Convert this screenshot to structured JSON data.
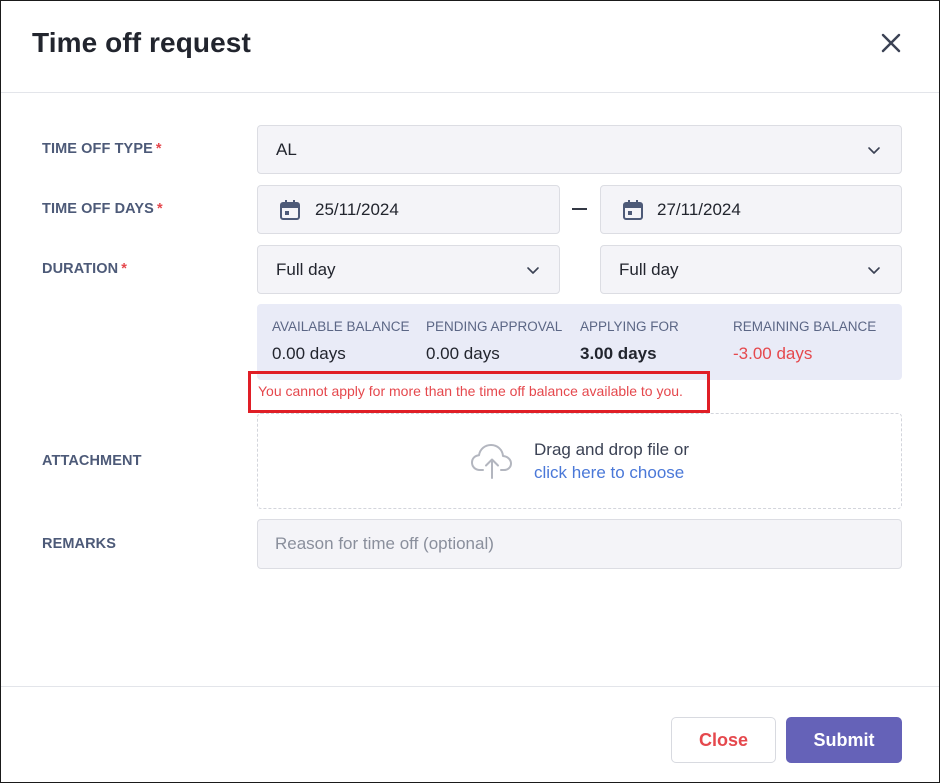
{
  "dialog": {
    "title": "Time off request"
  },
  "form": {
    "time_off_type": {
      "label": "TIME OFF TYPE",
      "required_mark": "*",
      "value": "AL"
    },
    "time_off_days": {
      "label": "TIME OFF DAYS",
      "required_mark": "*",
      "start_date": "25/11/2024",
      "separator": "–",
      "end_date": "27/11/2024"
    },
    "duration": {
      "label": "DURATION",
      "required_mark": "*",
      "start_value": "Full day",
      "end_value": "Full day"
    },
    "balance": {
      "available": {
        "label": "AVAILABLE BALANCE",
        "value": "0.00 days"
      },
      "pending": {
        "label": "PENDING APPROVAL",
        "value": "0.00 days"
      },
      "applying": {
        "label": "APPLYING FOR",
        "value": "3.00 days"
      },
      "remaining": {
        "label": "REMAINING BALANCE",
        "value": "-3.00 days"
      }
    },
    "error_message": "You cannot apply for more than the time off balance available to you.",
    "attachment": {
      "label": "ATTACHMENT",
      "drop_text": "Drag and drop file or",
      "choose_link": "click here to choose"
    },
    "remarks": {
      "label": "REMARKS",
      "placeholder": "Reason for time off (optional)"
    }
  },
  "footer": {
    "close_label": "Close",
    "submit_label": "Submit"
  },
  "colors": {
    "accent": "#6562b8",
    "error": "#e5484d",
    "link": "#4a78d8",
    "highlight_box": "#e01e26",
    "balance_bg": "#e9ebf7"
  },
  "icons": {
    "close": "close-icon",
    "dropdown": "chevron-down-icon",
    "calendar": "calendar-icon",
    "upload": "cloud-upload-icon"
  }
}
